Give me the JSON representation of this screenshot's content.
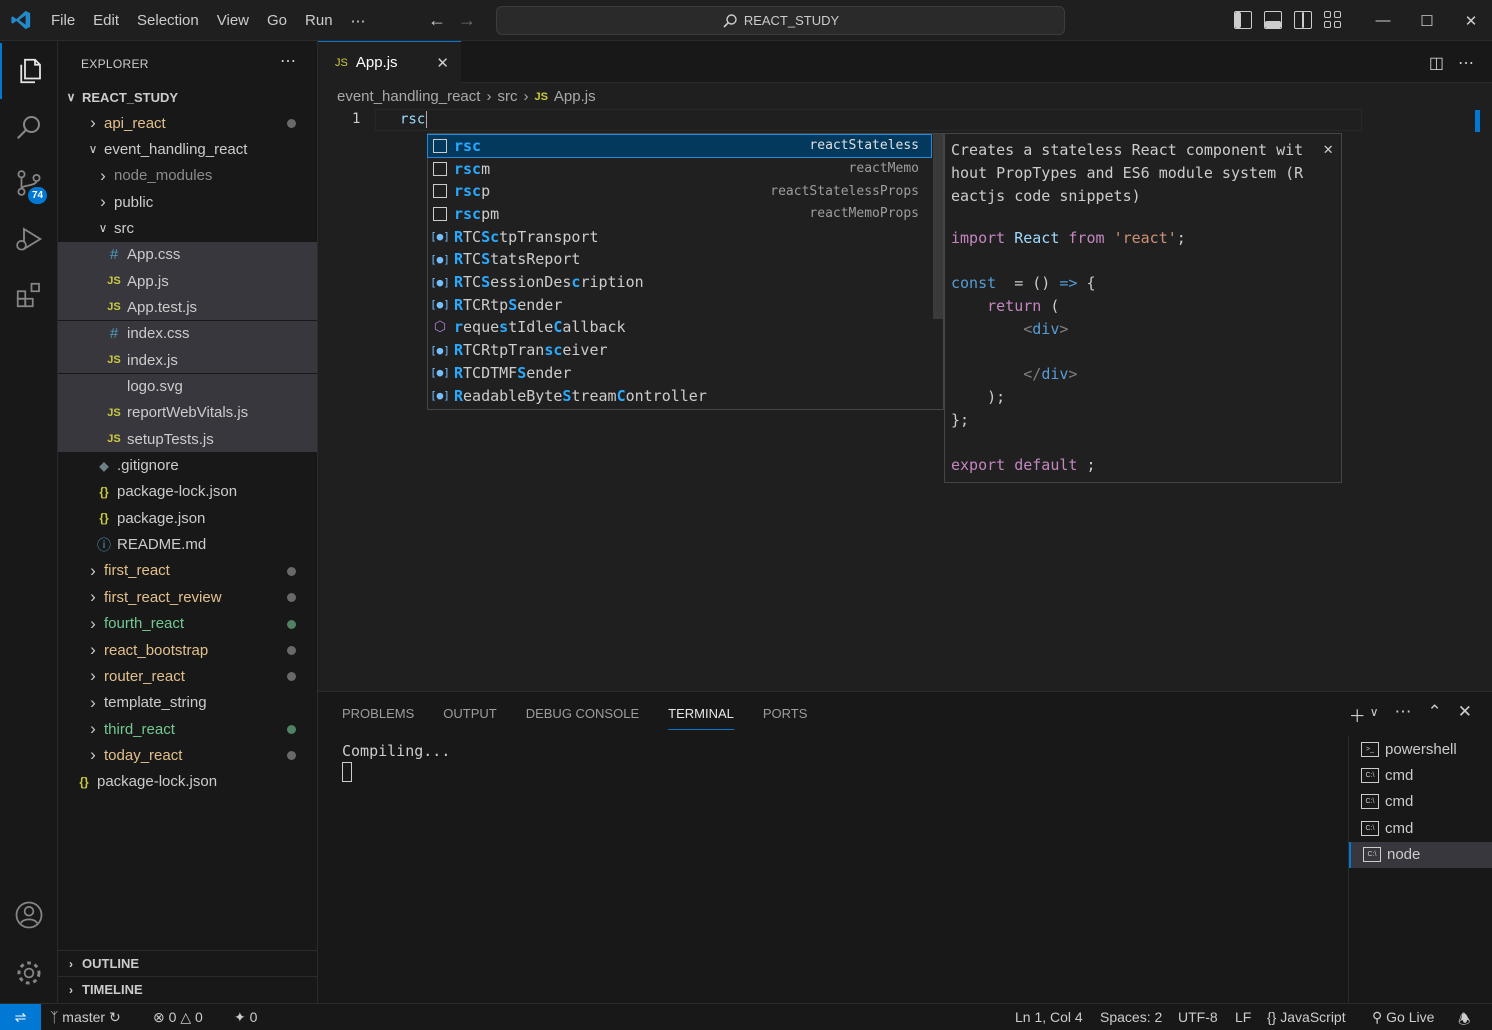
{
  "titlebar": {
    "menu": [
      "File",
      "Edit",
      "Selection",
      "View",
      "Go",
      "Run",
      "⋯"
    ],
    "search": "REACT_STUDY"
  },
  "activity": {
    "scm_badge": "74"
  },
  "sidebar": {
    "title": "EXPLORER",
    "root": "REACT_STUDY",
    "items": [
      {
        "label": "api_react",
        "kind": "folder",
        "depth": 1,
        "open": false,
        "color": "yellow",
        "dot": "gray"
      },
      {
        "label": "event_handling_react",
        "kind": "folder",
        "depth": 1,
        "open": true,
        "color": "normal"
      },
      {
        "label": "node_modules",
        "kind": "folder",
        "depth": 2,
        "open": false,
        "color": "dim"
      },
      {
        "label": "public",
        "kind": "folder",
        "depth": 2,
        "open": false,
        "color": "normal"
      },
      {
        "label": "src",
        "kind": "folder",
        "depth": 2,
        "open": true,
        "color": "normal"
      },
      {
        "label": "App.css",
        "kind": "css",
        "depth": 3,
        "sel": true
      },
      {
        "label": "App.js",
        "kind": "js",
        "depth": 3,
        "sel": true
      },
      {
        "label": "App.test.js",
        "kind": "js",
        "depth": 3,
        "sel": true
      },
      {
        "label": "index.css",
        "kind": "css",
        "depth": 3,
        "sel": true
      },
      {
        "label": "index.js",
        "kind": "js",
        "depth": 3,
        "sel": true
      },
      {
        "label": "logo.svg",
        "kind": "svg",
        "depth": 3,
        "sel": true
      },
      {
        "label": "reportWebVitals.js",
        "kind": "js",
        "depth": 3,
        "sel": true
      },
      {
        "label": "setupTests.js",
        "kind": "js",
        "depth": 3,
        "sel": true
      },
      {
        "label": ".gitignore",
        "kind": "git",
        "depth": 2
      },
      {
        "label": "package-lock.json",
        "kind": "json",
        "depth": 2
      },
      {
        "label": "package.json",
        "kind": "json",
        "depth": 2
      },
      {
        "label": "README.md",
        "kind": "info",
        "depth": 2
      },
      {
        "label": "first_react",
        "kind": "folder",
        "depth": 1,
        "open": false,
        "color": "yellow",
        "dot": "gray"
      },
      {
        "label": "first_react_review",
        "kind": "folder",
        "depth": 1,
        "open": false,
        "color": "yellow",
        "dot": "gray"
      },
      {
        "label": "fourth_react",
        "kind": "folder",
        "depth": 1,
        "open": false,
        "color": "green",
        "dot": "green"
      },
      {
        "label": "react_bootstrap",
        "kind": "folder",
        "depth": 1,
        "open": false,
        "color": "yellow",
        "dot": "gray"
      },
      {
        "label": "router_react",
        "kind": "folder",
        "depth": 1,
        "open": false,
        "color": "yellow",
        "dot": "gray"
      },
      {
        "label": "template_string",
        "kind": "folder",
        "depth": 1,
        "open": false,
        "color": "normal"
      },
      {
        "label": "third_react",
        "kind": "folder",
        "depth": 1,
        "open": false,
        "color": "green",
        "dot": "green"
      },
      {
        "label": "today_react",
        "kind": "folder",
        "depth": 1,
        "open": false,
        "color": "yellow",
        "dot": "gray"
      },
      {
        "label": "package-lock.json",
        "kind": "json",
        "depth": 0
      }
    ],
    "outline": "OUTLINE",
    "timeline": "TIMELINE"
  },
  "editor": {
    "tab": "App.js",
    "breadcrumb": [
      "event_handling_react",
      "src",
      "App.js"
    ],
    "line_number": "1",
    "line_text": "rsc"
  },
  "suggest": [
    {
      "label": "rsc",
      "match": "rsc",
      "rest": "",
      "detail": "reactStateless",
      "icon": "snippet",
      "selected": true
    },
    {
      "label": "rscm",
      "match": "rsc",
      "rest": "m",
      "detail": "reactMemo",
      "icon": "snippet"
    },
    {
      "label": "rscp",
      "match": "rsc",
      "rest": "p",
      "detail": "reactStatelessProps",
      "icon": "snippet"
    },
    {
      "label": "rscpm",
      "match": "rsc",
      "rest": "pm",
      "detail": "reactMemoProps",
      "icon": "snippet"
    },
    {
      "label": "RTCSctpTransport",
      "html": "<b>R</b>TC<b>Sc</b>tpTransport",
      "icon": "variable"
    },
    {
      "label": "RTCStatsReport",
      "html": "<b>R</b>TC<b>S</b>tatsReport",
      "icon": "variable"
    },
    {
      "label": "RTCSessionDescription",
      "html": "<b>R</b>TC<b>S</b>essionDes<b>c</b>ription",
      "icon": "variable"
    },
    {
      "label": "RTCRtpSender",
      "html": "<b>R</b>TCRtp<b>S</b>ender",
      "icon": "variable"
    },
    {
      "label": "requestIdleCallback",
      "html": "<b>r</b>eque<b>s</b>tIdle<b>C</b>allback",
      "icon": "method"
    },
    {
      "label": "RTCRtpTransceiver",
      "html": "<b>R</b>TCRtpTran<b>sc</b>eiver",
      "icon": "variable"
    },
    {
      "label": "RTCDTMFSender",
      "html": "<b>R</b>TCDTMF<b>S</b>ender",
      "icon": "variable"
    },
    {
      "label": "ReadableByteStreamController",
      "html": "<b>R</b>eadableByte<b>S</b>tream<b>C</b>ontroller",
      "icon": "variable"
    }
  ],
  "docs": {
    "description": "Creates a stateless React component wit\nhout PropTypes and ES6 module system (R\neactjs code snippets)"
  },
  "panel": {
    "tabs": [
      "PROBLEMS",
      "OUTPUT",
      "DEBUG CONSOLE",
      "TERMINAL",
      "PORTS"
    ],
    "active_tab": "TERMINAL",
    "terminal_text": "Compiling...",
    "terminals": [
      {
        "name": "powershell",
        "icon": "ps"
      },
      {
        "name": "cmd",
        "icon": "cmd"
      },
      {
        "name": "cmd",
        "icon": "cmd"
      },
      {
        "name": "cmd",
        "icon": "cmd"
      },
      {
        "name": "node",
        "icon": "cmd",
        "selected": true
      }
    ]
  },
  "statusbar": {
    "branch": "master",
    "errors": "0",
    "warnings": "0",
    "ports": "0",
    "position": "Ln 1, Col 4",
    "spaces": "Spaces: 2",
    "encoding": "UTF-8",
    "eol": "LF",
    "language": "JavaScript",
    "golive": "Go Live"
  },
  "colors": {
    "accent": "#0078d4",
    "modified": "#e2c08d",
    "untracked": "#73c991",
    "match": "#2aaaff"
  }
}
